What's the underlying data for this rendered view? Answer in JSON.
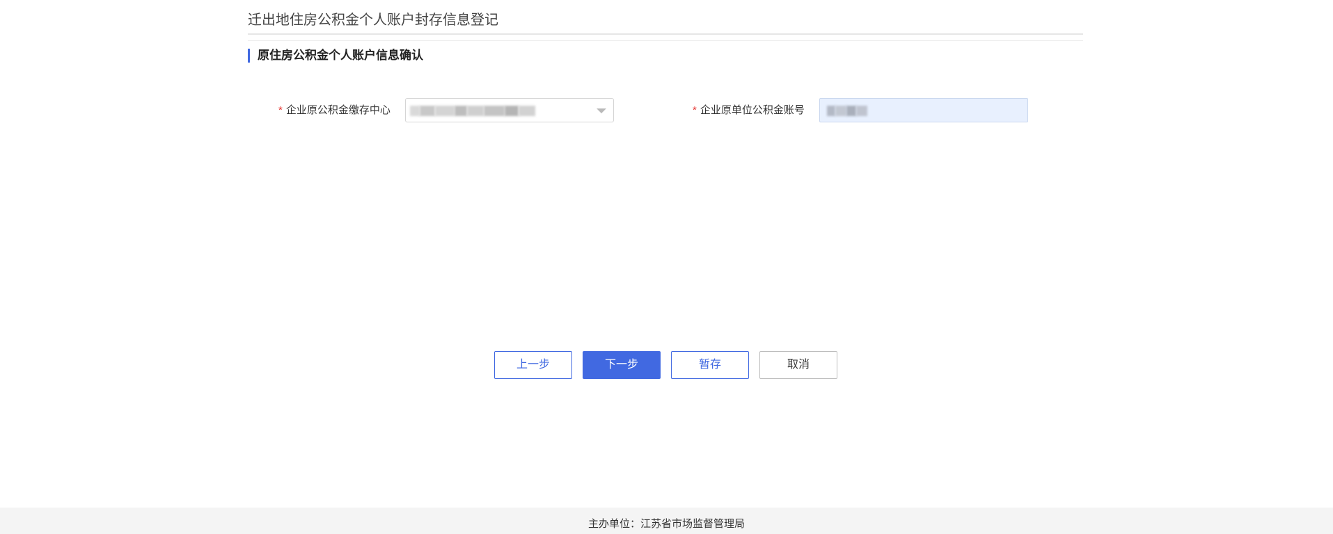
{
  "page": {
    "title": "迁出地住房公积金个人账户封存信息登记"
  },
  "section": {
    "title": "原住房公积金个人账户信息确认"
  },
  "form": {
    "required_mark": "*",
    "center_label": "企业原公积金缴存中心",
    "account_label": "企业原单位公积金账号"
  },
  "buttons": {
    "prev": "上一步",
    "next": "下一步",
    "save": "暂存",
    "cancel": "取消"
  },
  "footer": {
    "text": "主办单位：江苏省市场监督管理局"
  },
  "colors": {
    "accent": "#4169e1",
    "required": "#e53935",
    "input_autofill_bg": "#e8f0fe",
    "footer_bg": "#f4f4f4"
  }
}
